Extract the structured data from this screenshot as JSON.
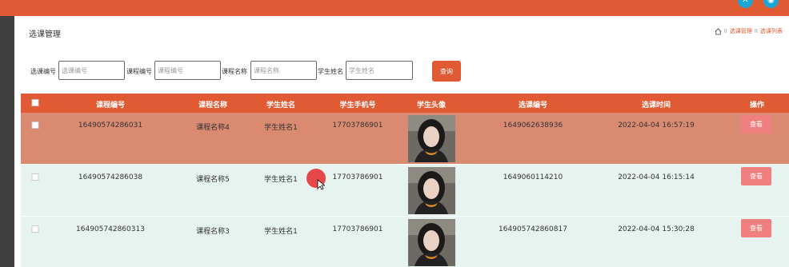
{
  "header": {
    "icons": [
      "tools-icon",
      "user-icon"
    ]
  },
  "page": {
    "title": "选课管理"
  },
  "breadcrumb": {
    "sep": "II",
    "items": [
      "选课管理",
      "选课列表"
    ]
  },
  "search": {
    "fields": [
      {
        "label": "选课编号",
        "placeholder": "选课编号"
      },
      {
        "label": "课程编号",
        "placeholder": "课程编号"
      },
      {
        "label": "课程名称",
        "placeholder": "课程名称"
      },
      {
        "label": "学生姓名",
        "placeholder": "学生姓名"
      }
    ],
    "button": "查询"
  },
  "table": {
    "columns": [
      "课程编号",
      "课程名称",
      "学生姓名",
      "学生手机号",
      "学生头像",
      "选课编号",
      "选课时间",
      "操作"
    ],
    "rows": [
      {
        "course_no": "16490574286031",
        "course_name": "课程名称4",
        "student_name": "学生姓名1",
        "phone": "17703786901",
        "select_no": "1649062638936",
        "time": "2022-04-04 16:57:19",
        "action": "查看"
      },
      {
        "course_no": "16490574286038",
        "course_name": "课程名称5",
        "student_name": "学生姓名1",
        "phone": "17703786901",
        "select_no": "1649060114210",
        "time": "2022-04-04 16:15:14",
        "action": "查看"
      },
      {
        "course_no": "164905742860313",
        "course_name": "课程名称3",
        "student_name": "学生姓名1",
        "phone": "17703786901",
        "select_no": "164905742860817",
        "time": "2022-04-04 15:30:28",
        "action": "查看"
      }
    ]
  },
  "colors": {
    "accent": "#e05a33",
    "selected_row": "#d98a70",
    "row_bg": "#e7f3ee",
    "view_button": "#f08080"
  }
}
